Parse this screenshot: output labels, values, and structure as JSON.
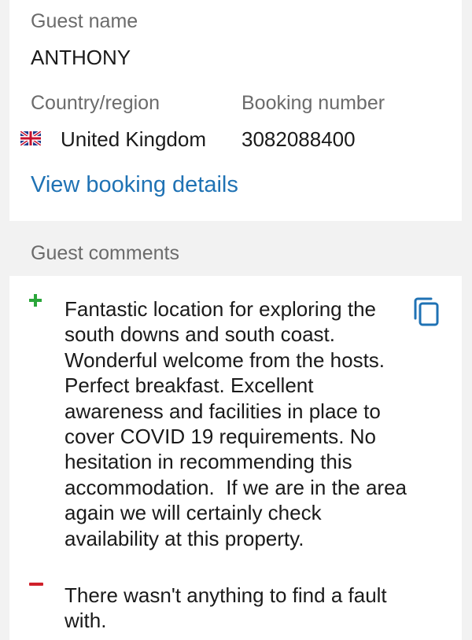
{
  "guest": {
    "name_label": "Guest name",
    "name_value": "ANTHONY",
    "country_label": "Country/region",
    "country_value": "United Kingdom",
    "booking_label": "Booking number",
    "booking_value": "3082088400",
    "view_details_link": "View booking details"
  },
  "comments": {
    "section_title": "Guest comments",
    "positive": "Fantastic location for exploring the south downs and south coast. Wonderful welcome from the hosts. Perfect breakfast. Excellent awareness and facilities in place to cover COVID 19 requirements. No hesitation in recommending this accommodation.  If we are in the area again we will certainly check availability at this property.",
    "negative": "There wasn't anything to find a fault with."
  },
  "icons": {
    "flag": "uk-flag-icon",
    "plus": "plus-icon",
    "minus": "minus-icon",
    "copy": "copy-icon"
  },
  "colors": {
    "link": "#1f72b4",
    "positive": "#2aa63a",
    "negative": "#d0202a",
    "label": "#6b6b6b",
    "background": "#f2f2f2"
  }
}
